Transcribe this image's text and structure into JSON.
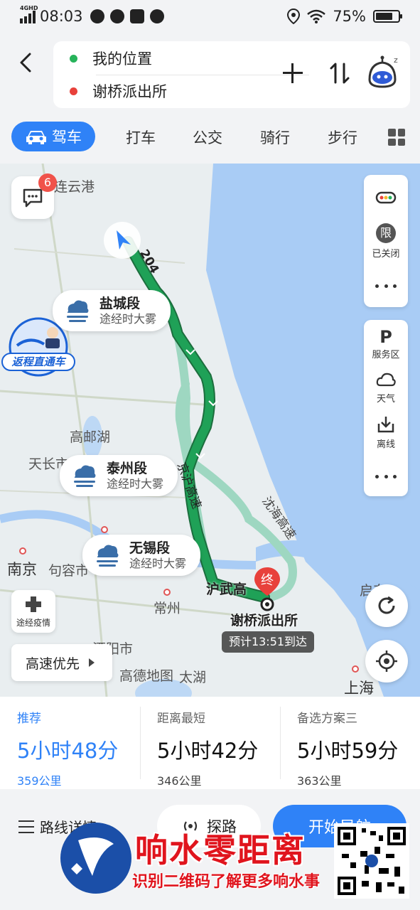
{
  "status_bar": {
    "network": "4GHD",
    "time": "08:03",
    "battery": "75%",
    "battery_level": 0.75
  },
  "header": {
    "origin": "我的位置",
    "destination": "谢桥派出所",
    "colors": {
      "origin_dot": "#27b35a",
      "destination_dot": "#e8413b"
    }
  },
  "tabs": [
    {
      "label": "驾车",
      "active": true
    },
    {
      "label": "打车"
    },
    {
      "label": "公交"
    },
    {
      "label": "骑行"
    },
    {
      "label": "步行"
    }
  ],
  "map": {
    "message_badge": "6",
    "promo": "返程直通车",
    "labels": {
      "lianyungang": "连云港",
      "gaoyouhu": "高邮湖",
      "tianchang": "天长市",
      "nanjing": "南京",
      "jurong": "句容市",
      "changzhou": "常州",
      "liyang": "溧阳市",
      "amap_logo": "高德地图",
      "taihu": "太湖",
      "shanghai": "上海",
      "qidong": "启东",
      "road_shenhai": "沈海高速",
      "road_huwu": "沪武高",
      "road_jingjing": "京沪高速",
      "road_204": "204"
    },
    "weather": [
      {
        "title": "盐城段",
        "subtitle": "途经时大雾"
      },
      {
        "title": "泰州段",
        "subtitle": "途经时大雾"
      },
      {
        "title": "无锡段",
        "subtitle": "途经时大雾"
      }
    ],
    "side_panel_top": {
      "restrict_badge": "限",
      "restrict_label": "已关闭"
    },
    "side_panel_mid": {
      "service_area": "服务区",
      "weather": "天气",
      "offline": "离线"
    },
    "epidemic": "途经疫情",
    "highway_pref": "高速优先",
    "dest_marker": "终",
    "dest_name": "谢桥派出所",
    "eta": "预计13:51到达",
    "colors": {
      "route_main": "#1fa157",
      "route_alt": "#9ed7c1",
      "water": "#a9ccf5",
      "land": "#e9eef0"
    }
  },
  "routes": [
    {
      "label": "推荐",
      "time": "5小时48分",
      "distance": "359公里",
      "selected": true
    },
    {
      "label": "距离最短",
      "time": "5小时42分",
      "distance": "346公里"
    },
    {
      "label": "备选方案三",
      "time": "5小时59分",
      "distance": "363公里"
    }
  ],
  "actions": {
    "detail": "路线详情",
    "explore": "探路",
    "start": "开始导航"
  },
  "watermark": {
    "title": "响水零距离",
    "subtitle": "识别二维码了解更多响水事"
  }
}
